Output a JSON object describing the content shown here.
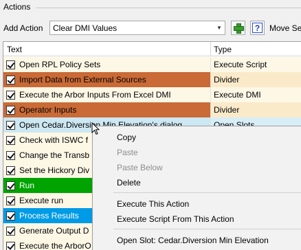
{
  "panel": {
    "title": "Actions"
  },
  "toolbar": {
    "add_action_label": "Add Action",
    "add_action_value": "Clear DMI Values",
    "add_button_icon": "plus-icon",
    "help_button_label": "?",
    "move_label": "Move Se"
  },
  "table": {
    "columns": [
      "Text",
      "Type"
    ],
    "rows": [
      {
        "text": "Open RPL Policy Sets",
        "type": "Execute Script",
        "checked": true,
        "row_color": "default"
      },
      {
        "text": "Import Data from External Sources",
        "type": "Divider",
        "checked": true,
        "row_color": "#c96a37"
      },
      {
        "text": "Execute the Arbor Inputs From Excel DMI",
        "type": "Execute DMI",
        "checked": true,
        "row_color": "default"
      },
      {
        "text": "Operator Inputs",
        "type": "Divider",
        "checked": true,
        "row_color": "#c96a37"
      },
      {
        "text": "Open Cedar.Diversion Min Elevation's dialog",
        "type": "Open Slots",
        "checked": true,
        "row_color": "selected"
      },
      {
        "text": "Check with ISWC f",
        "type": "",
        "checked": true,
        "row_color": "default"
      },
      {
        "text": "Change the Transb",
        "type": "",
        "checked": true,
        "row_color": "default"
      },
      {
        "text": "Set the Hickory Div",
        "type": "",
        "checked": true,
        "row_color": "default"
      },
      {
        "text": "Run",
        "type": "",
        "checked": true,
        "row_color": "#00a300"
      },
      {
        "text": "Execute run",
        "type": "",
        "checked": true,
        "row_color": "default"
      },
      {
        "text": "Process Results",
        "type": "",
        "checked": true,
        "row_color": "#009be6"
      },
      {
        "text": "Generate Output D",
        "type": "",
        "checked": true,
        "row_color": "default"
      },
      {
        "text": "Execute the ArborO",
        "type": "",
        "checked": true,
        "row_color": "default"
      }
    ]
  },
  "context_menu": {
    "items": [
      {
        "label": "Copy",
        "enabled": true
      },
      {
        "label": "Paste",
        "enabled": false
      },
      {
        "label": "Paste Below",
        "enabled": false
      },
      {
        "label": "Delete",
        "enabled": true
      },
      {
        "label": "Execute This Action",
        "enabled": true
      },
      {
        "label": "Execute Script From This Action",
        "enabled": true
      },
      {
        "label": "Open Slot: Cedar.Diversion Min Elevation",
        "enabled": true
      }
    ]
  }
}
